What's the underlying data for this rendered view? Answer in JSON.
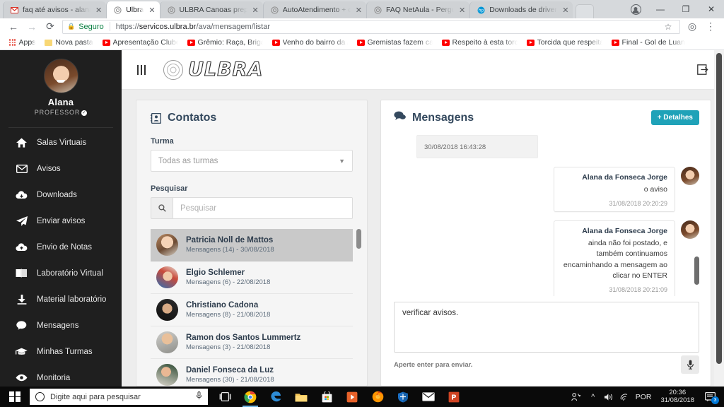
{
  "browser": {
    "tabs": [
      {
        "title": "faq até avisos - alanada",
        "favicon": "gmail-icon",
        "active": false
      },
      {
        "title": "Ulbra",
        "favicon": "ulbra-icon",
        "active": true
      },
      {
        "title": "ULBRA Canoas prepara",
        "favicon": "ulbra-icon",
        "active": false
      },
      {
        "title": "AutoAtendimento + co",
        "favicon": "ulbra-icon",
        "active": false
      },
      {
        "title": "FAQ NetAula - Pergunta",
        "favicon": "ulbra-icon",
        "active": false
      },
      {
        "title": "Downloads de driver e",
        "favicon": "hp-icon",
        "active": false
      }
    ],
    "url": {
      "security_label": "Seguro",
      "scheme": "https://",
      "host": "servicos.ulbra.br",
      "path": "/ava/mensagem/listar"
    },
    "bookmarks": [
      {
        "label": "Apps",
        "icon": "apps-grid-icon"
      },
      {
        "label": "Nova pasta",
        "icon": "folder-icon"
      },
      {
        "label": "Apresentação Clube",
        "icon": "youtube-icon"
      },
      {
        "label": "Grêmio: Raça, Briga e",
        "icon": "youtube-icon"
      },
      {
        "label": "Venho do bairro da A",
        "icon": "youtube-icon"
      },
      {
        "label": "Gremistas fazem casa",
        "icon": "youtube-icon"
      },
      {
        "label": "Respeito à esta torcid",
        "icon": "youtube-icon"
      },
      {
        "label": "Torcida que respeita",
        "icon": "youtube-icon"
      },
      {
        "label": "Final - Gol de Luan",
        "icon": "youtube-icon"
      }
    ],
    "window_controls": {
      "minimize": "—",
      "maximize": "❐",
      "close": "✕"
    }
  },
  "sidebar": {
    "user_name": "Alana",
    "user_role": "PROFESSOR",
    "items": [
      {
        "label": "Salas Virtuais",
        "icon": "home-icon"
      },
      {
        "label": "Avisos",
        "icon": "envelope-icon"
      },
      {
        "label": "Downloads",
        "icon": "cloud-download-icon"
      },
      {
        "label": "Enviar avisos",
        "icon": "paper-plane-icon"
      },
      {
        "label": "Envio de Notas",
        "icon": "cloud-upload-icon"
      },
      {
        "label": "Laboratório Virtual",
        "icon": "book-icon"
      },
      {
        "label": "Material laboratório",
        "icon": "download-icon"
      },
      {
        "label": "Mensagens",
        "icon": "chat-bubble-icon"
      },
      {
        "label": "Minhas Turmas",
        "icon": "graduation-cap-icon"
      },
      {
        "label": "Monitoria",
        "icon": "eye-icon"
      }
    ]
  },
  "topbar": {
    "brand": "ULBRA",
    "menu_icon": "hamburger-icon",
    "logout_icon": "logout-icon"
  },
  "contacts": {
    "title": "Contatos",
    "turma_label": "Turma",
    "turma_value": "Todas as turmas",
    "pesquisar_label": "Pesquisar",
    "search_placeholder": "Pesquisar",
    "search_value": "",
    "list": [
      {
        "name": "Patricia Noll de Mattos",
        "meta": "Mensagens (14) - 30/08/2018",
        "selected": true
      },
      {
        "name": "Elgio Schlemer",
        "meta": "Mensagens (6) - 22/08/2018",
        "selected": false
      },
      {
        "name": "Christiano Cadona",
        "meta": "Mensagens (8) - 21/08/2018",
        "selected": false
      },
      {
        "name": "Ramon dos Santos Lummertz",
        "meta": "Mensagens (3) - 21/08/2018",
        "selected": false
      },
      {
        "name": "Daniel Fonseca da Luz",
        "meta": "Mensagens (30) - 21/08/2018",
        "selected": false
      }
    ]
  },
  "messages": {
    "title": "Mensagens",
    "details_button": "+ Detalhes",
    "date_divider": "30/08/2018 16:43:28",
    "items": [
      {
        "author": "Alana da Fonseca Jorge",
        "text": "o aviso",
        "time": "31/08/2018 20:20:29"
      },
      {
        "author": "Alana da Fonseca Jorge",
        "text": "ainda não foi postado, e também continuamos encaminhando a mensagem ao clicar no ENTER",
        "time": "31/08/2018 20:21:09"
      }
    ],
    "composer_value": "verificar avisos.",
    "composer_hint": "Aperte enter para enviar.",
    "mic_icon": "microphone-icon"
  },
  "taskbar": {
    "search_placeholder": "Digite aqui para pesquisar",
    "apps": [
      {
        "name": "task-view-icon"
      },
      {
        "name": "chrome-icon"
      },
      {
        "name": "edge-icon"
      },
      {
        "name": "file-explorer-icon"
      },
      {
        "name": "microsoft-store-icon"
      },
      {
        "name": "media-player-icon"
      },
      {
        "name": "firefox-icon"
      },
      {
        "name": "windows-defender-icon"
      },
      {
        "name": "mail-icon"
      },
      {
        "name": "powerpoint-icon"
      }
    ],
    "tray": {
      "language": "POR",
      "time": "20:36",
      "date": "31/08/2018",
      "notification_count": "3"
    }
  },
  "colors": {
    "accent_teal": "#1fa2b8",
    "sidebar_bg": "#1f1f1f",
    "page_bg": "#ededed",
    "secure_green": "#0b8043"
  }
}
